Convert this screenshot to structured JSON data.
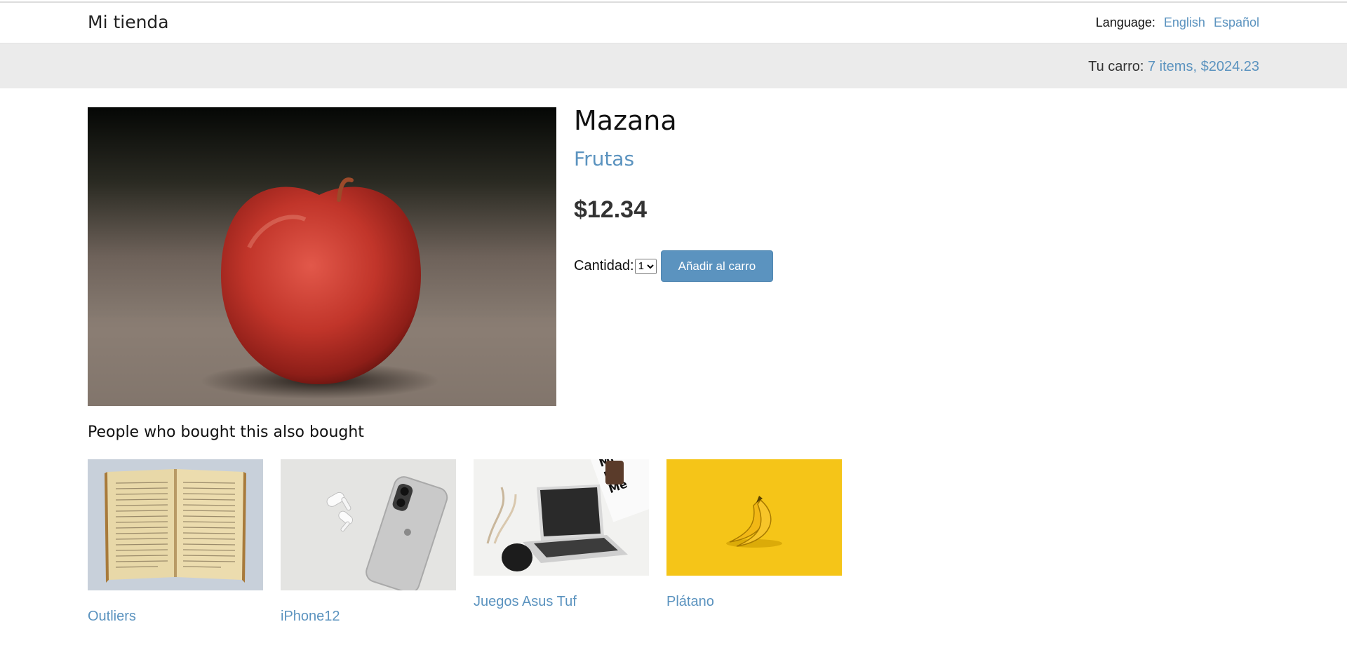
{
  "header": {
    "brand": "Mi tienda",
    "language_label": "Language:",
    "languages": [
      "English",
      "Español"
    ]
  },
  "cart": {
    "label": "Tu carro:",
    "summary": "7 items, $2024.23"
  },
  "product": {
    "name": "Mazana",
    "category": "Frutas",
    "price": "$12.34",
    "quantity_label": "Cantidad:",
    "quantity_value": "1",
    "add_button": "Añadir al carro"
  },
  "recommendations": {
    "heading": "People who bought this also bought",
    "items": [
      {
        "name": "Outliers"
      },
      {
        "name": "iPhone12"
      },
      {
        "name": "Juegos Asus Tuf"
      },
      {
        "name": "Plátano"
      }
    ]
  },
  "colors": {
    "link": "#5b93bf",
    "cart_bar": "#ebebeb",
    "button": "#5b93bf"
  }
}
